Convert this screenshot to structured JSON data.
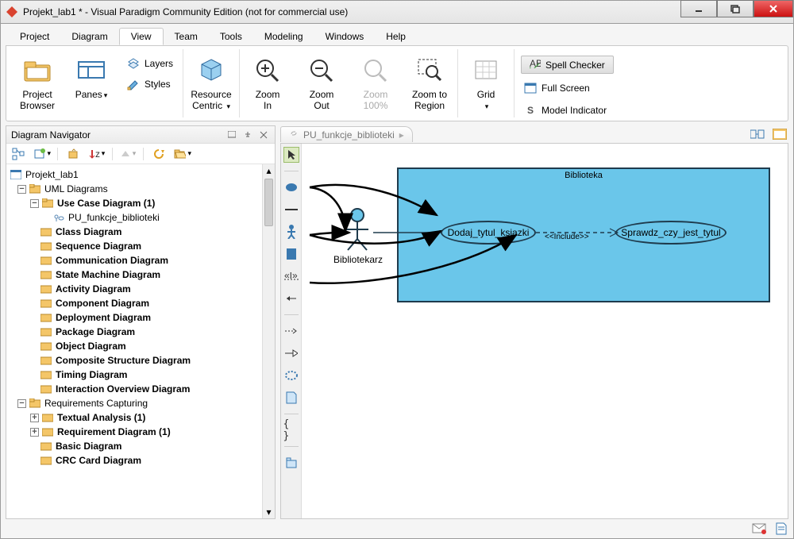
{
  "window": {
    "title": "Projekt_lab1 * - Visual Paradigm Community Edition (not for commercial use)"
  },
  "menu": {
    "project": "Project",
    "diagram": "Diagram",
    "view": "View",
    "team": "Team",
    "tools": "Tools",
    "modeling": "Modeling",
    "windows": "Windows",
    "help": "Help",
    "active": "view"
  },
  "ribbon": {
    "project_browser": "Project\nBrowser",
    "panes": "Panes",
    "layers": "Layers",
    "styles": "Styles",
    "resource_centric": "Resource\nCentric",
    "zoom_in": "Zoom\nIn",
    "zoom_out": "Zoom\nOut",
    "zoom_100": "Zoom\n100%",
    "zoom_region": "Zoom to\nRegion",
    "grid": "Grid",
    "spell_checker": "Spell Checker",
    "full_screen": "Full Screen",
    "model_indicator": "Model Indicator"
  },
  "navigator": {
    "title": "Diagram Navigator",
    "root": "Projekt_lab1",
    "groups": {
      "uml": "UML Diagrams",
      "usecase": "Use Case Diagram (1)",
      "usecase_child": "PU_funkcje_biblioteki",
      "class": "Class Diagram",
      "sequence": "Sequence Diagram",
      "communication": "Communication Diagram",
      "state": "State Machine Diagram",
      "activity": "Activity Diagram",
      "component": "Component Diagram",
      "deployment": "Deployment Diagram",
      "package": "Package Diagram",
      "object": "Object Diagram",
      "composite": "Composite Structure Diagram",
      "timing": "Timing Diagram",
      "interaction": "Interaction Overview Diagram",
      "req_cap": "Requirements Capturing",
      "textual": "Textual Analysis (1)",
      "requirement": "Requirement Diagram (1)",
      "basic": "Basic Diagram",
      "crc": "CRC Card Diagram"
    }
  },
  "tab": {
    "label": "PU_funkcje_biblioteki"
  },
  "diagram": {
    "system": "Biblioteka",
    "actor": "Bibliotekarz",
    "uc1": "Dodaj_tytul_ksiazki",
    "uc2": "Sprawdz_czy_jest_tytul",
    "include": "<<Include>>"
  }
}
